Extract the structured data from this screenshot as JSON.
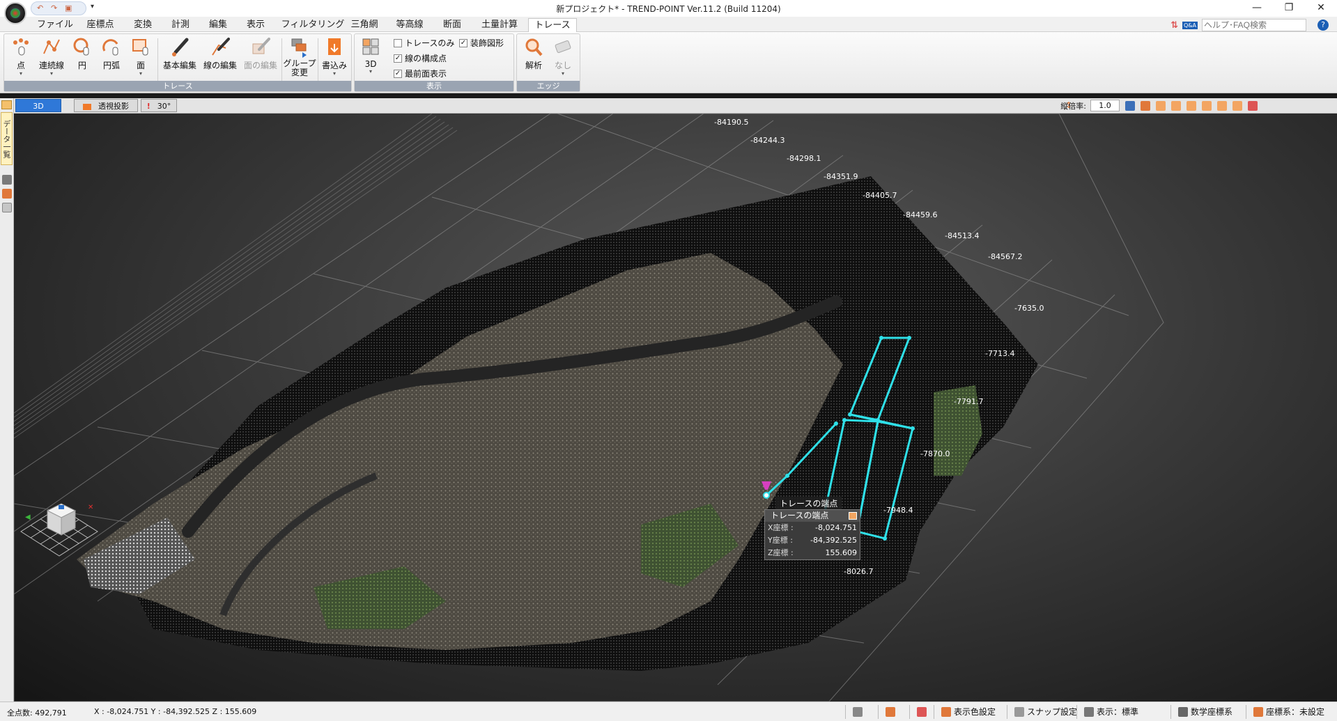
{
  "window": {
    "title": "新プロジェクト* - TREND-POINT Ver.11.2 (Build 11204)",
    "qat_dropdown": "▾",
    "minimize": "—",
    "restore": "❐",
    "close": "✕"
  },
  "tabs": [
    {
      "label": "ファイル"
    },
    {
      "label": "座標点"
    },
    {
      "label": "変換"
    },
    {
      "label": "計測"
    },
    {
      "label": "編集"
    },
    {
      "label": "表示"
    },
    {
      "label": "フィルタリング"
    },
    {
      "label": "三角網"
    },
    {
      "label": "等高線"
    },
    {
      "label": "断面"
    },
    {
      "label": "土量計算"
    },
    {
      "label": "トレース",
      "active": true
    }
  ],
  "help": {
    "qa_badge": "Q&A",
    "search_placeholder": "ヘルプ･FAQ検索",
    "help_icon": "?"
  },
  "ribbon": {
    "groups": {
      "trace": "トレース",
      "display": "表示",
      "edge": "エッジ"
    },
    "buttons": {
      "point": "点",
      "polyline": "連続線",
      "circle": "円",
      "arc": "円弧",
      "face": "面",
      "basic_edit": "基本編集",
      "line_edit": "線の編集",
      "face_edit": "面の編集",
      "group_change_1": "グループ",
      "group_change_2": "変更",
      "write": "書込み",
      "view3d": "3D",
      "analyze": "解析",
      "none": "なし"
    },
    "checks": {
      "trace_only": {
        "label": "トレースのみ",
        "checked": false
      },
      "decoration": {
        "label": "装飾図形",
        "checked": true
      },
      "line_vertices": {
        "label": "線の構成点",
        "checked": true
      },
      "front_display": {
        "label": "最前面表示",
        "checked": true
      }
    }
  },
  "viewbar": {
    "tab_3d": "3D",
    "tab_perspective": "透視投影",
    "tab_angle": "30°",
    "zoom_label": "縦倍率:",
    "zoom_value": "1.0"
  },
  "side": {
    "data_tab": "データ一覧"
  },
  "view": {
    "x_ticks": [
      "-84190.5",
      "-84244.3",
      "-84298.1",
      "-84351.9",
      "-84405.7",
      "-84459.6",
      "-84513.4",
      "-84567.2"
    ],
    "y_ticks": [
      "-7635.0",
      "-7713.4",
      "-7791.7",
      "-7870.0",
      "-7948.4",
      "-8026.7"
    ],
    "trace_color": "#2fe0e8"
  },
  "tooltip": {
    "hover_label": "トレースの端点",
    "panel_title": "トレースの端点",
    "x_label": "X座標 :",
    "x_value": "-8,024.751",
    "y_label": "Y座標 :",
    "y_value": "-84,392.525",
    "z_label": "Z座標 :",
    "z_value": "155.609"
  },
  "status": {
    "point_count": "全点数: 492,791",
    "coords": "X : -8,024.751  Y : -84,392.525  Z : 155.609",
    "color_setting": "表示色設定",
    "snap_setting": "スナップ設定",
    "display_mode": "表示：標準",
    "math_coord": "数学座標系",
    "coord_system": "座標系：未設定"
  }
}
